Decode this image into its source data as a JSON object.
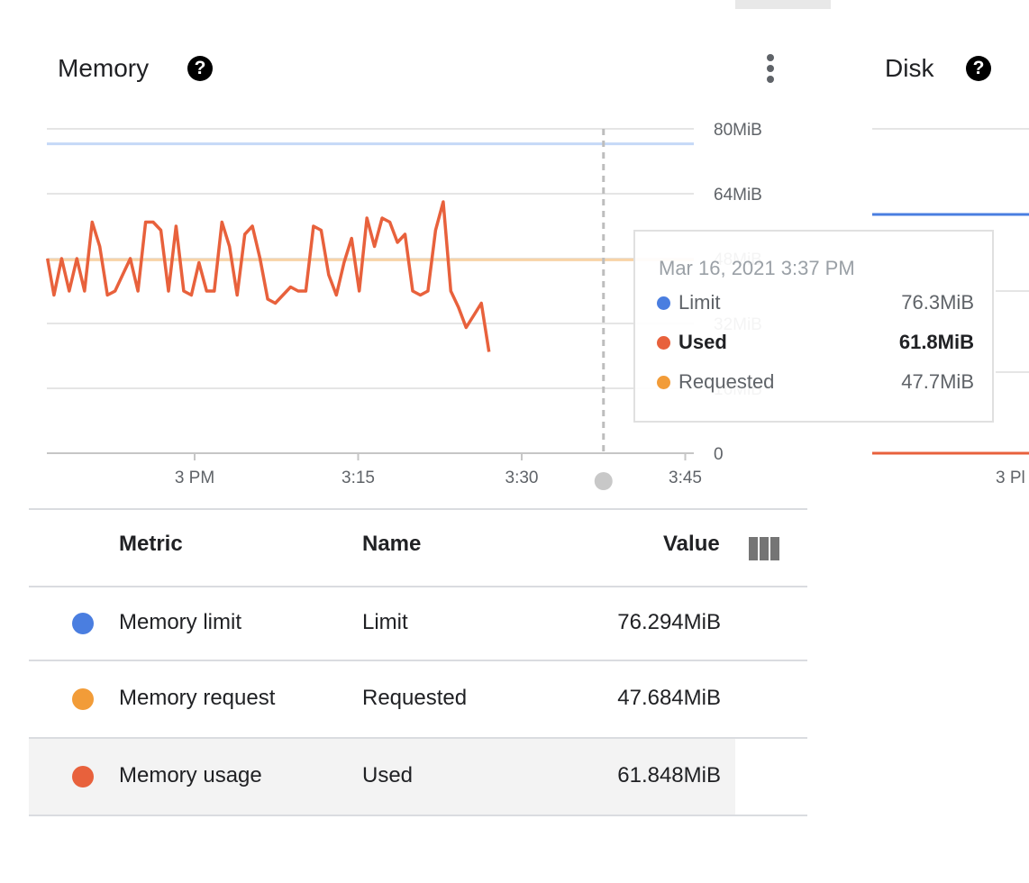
{
  "memory_card": {
    "title": "Memory",
    "help_icon": "question-circle-icon",
    "more_icon": "more-vert-icon"
  },
  "disk_card": {
    "title": "Disk",
    "help_icon": "question-circle-icon",
    "x_tick": "3 Pl",
    "series": [
      {
        "name": "Limit",
        "color": "#4a7ee0"
      },
      {
        "name": "Used",
        "color": "#e8613c"
      }
    ]
  },
  "chart_data": {
    "type": "line",
    "y_unit": "MiB",
    "ylim": [
      0,
      80
    ],
    "y_ticks": [
      "0",
      "16MiB",
      "32MiB",
      "48MiB",
      "64MiB",
      "80MiB"
    ],
    "x_ticks": [
      "3 PM",
      "3:15",
      "3:30",
      "3:45"
    ],
    "grid": true,
    "x_minutes_from_3pm": [
      -13.5,
      -12.9,
      -12.2,
      -11.5,
      -10.8,
      -10.1,
      -9.4,
      -8.7,
      -8.0,
      -7.3,
      -6.6,
      -5.9,
      -5.2,
      -4.5,
      -3.8,
      -3.1,
      -2.4,
      -1.7,
      -1.0,
      -0.3,
      0.4,
      1.1,
      1.8,
      2.5,
      3.2,
      3.9,
      4.6,
      5.3,
      6.0,
      6.7,
      7.4,
      8.1,
      8.8,
      9.5,
      10.2,
      10.9,
      11.6,
      12.3,
      13.0,
      13.7,
      14.4,
      15.1,
      15.8,
      16.5,
      17.2,
      17.9,
      18.6,
      19.3,
      20.0,
      20.7,
      21.4,
      22.1,
      22.8,
      23.5,
      24.2,
      24.9,
      25.6,
      26.3,
      27.0,
      27.7,
      28.4,
      29.1,
      29.8,
      30.5,
      31.2,
      31.9,
      32.6,
      33.3,
      34.0,
      34.7,
      35.4,
      36.1,
      36.8,
      37.5,
      38.2,
      38.9,
      39.6,
      40.3,
      41.0,
      41.7,
      42.4,
      43.1,
      43.8,
      44.5
    ],
    "series": [
      {
        "name": "Limit",
        "color": "#4a7ee0",
        "values": [
          76.3
        ]
      },
      {
        "name": "Requested",
        "color": "#f29c38",
        "values": [
          47.7
        ]
      },
      {
        "name": "Used",
        "color": "#e8613c",
        "values": [
          48,
          39,
          48,
          40,
          48,
          40,
          57,
          51,
          39,
          40,
          44,
          48,
          40,
          57,
          57,
          55,
          40,
          56,
          40,
          39,
          47,
          40,
          40,
          57,
          51,
          39,
          54,
          56,
          48,
          38,
          37,
          39,
          41,
          40,
          40,
          56,
          55,
          44,
          39,
          47,
          53,
          40,
          58,
          51,
          58,
          57,
          52,
          54,
          40,
          39,
          40,
          55,
          62,
          40,
          36,
          31,
          34,
          37,
          25
        ]
      }
    ]
  },
  "tooltip": {
    "date": "Mar 16, 2021 3:37 PM",
    "rows": [
      {
        "label": "Limit",
        "value": "76.3MiB",
        "color": "#4a7ee0"
      },
      {
        "label": "Used",
        "value": "61.8MiB",
        "color": "#e8613c"
      },
      {
        "label": "Requested",
        "value": "47.7MiB",
        "color": "#f29c38"
      }
    ]
  },
  "table": {
    "headers": {
      "metric": "Metric",
      "name": "Name",
      "value": "Value"
    },
    "column_icon": "column-chooser-icon",
    "rows": [
      {
        "metric": "Memory limit",
        "name": "Limit",
        "value": "76.294MiB",
        "color": "#4a7ee0"
      },
      {
        "metric": "Memory request",
        "name": "Requested",
        "value": "47.684MiB",
        "color": "#f29c38"
      },
      {
        "metric": "Memory usage",
        "name": "Used",
        "value": "61.848MiB",
        "color": "#e8613c"
      }
    ]
  }
}
